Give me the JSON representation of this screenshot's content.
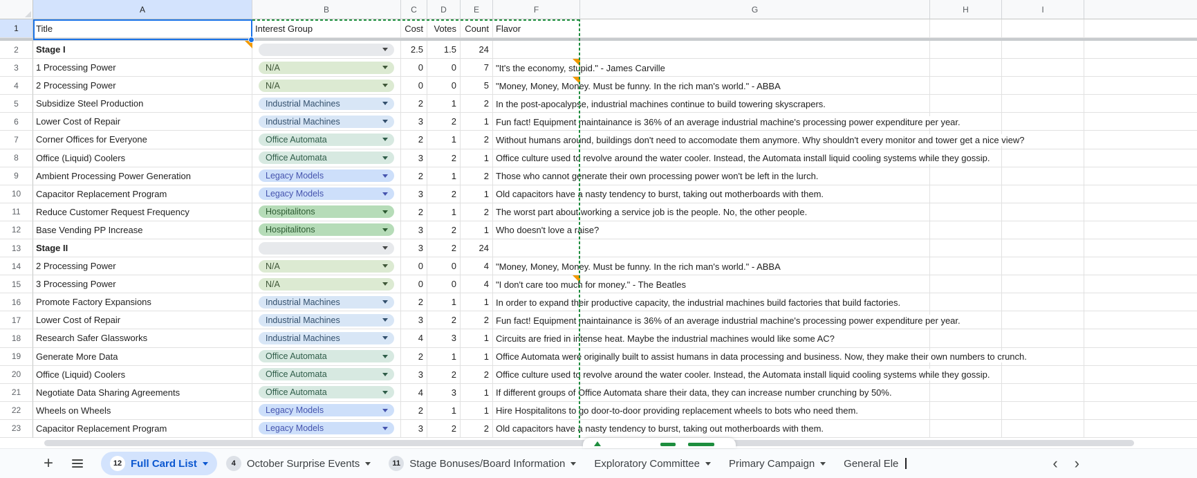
{
  "sheet": {
    "columns": [
      "A",
      "B",
      "C",
      "D",
      "E",
      "F",
      "G",
      "H",
      "I"
    ],
    "selected_cell": "A1",
    "header_row": {
      "num": "1",
      "title": "Title",
      "interest_group": "Interest Group",
      "cost": "Cost",
      "votes": "Votes",
      "count": "Count",
      "flavor": "Flavor"
    },
    "rows": [
      {
        "n": "2",
        "title": "Stage I",
        "bold": true,
        "group": "",
        "cost": "2.5",
        "votes": "1.5",
        "count": "24",
        "flavor": "",
        "notes": [
          "A"
        ]
      },
      {
        "n": "3",
        "title": "1 Processing Power",
        "bold": false,
        "group": "N/A",
        "cost": "0",
        "votes": "0",
        "count": "7",
        "flavor": "\"It's the economy, stupid.\" - James Carville",
        "notes": [
          "F"
        ]
      },
      {
        "n": "4",
        "title": "2 Processing Power",
        "bold": false,
        "group": "N/A",
        "cost": "0",
        "votes": "0",
        "count": "5",
        "flavor": "\"Money, Money, Money. Must be funny. In the rich man's world.\" - ABBA",
        "notes": [
          "F"
        ]
      },
      {
        "n": "5",
        "title": "Subsidize Steel Production",
        "bold": false,
        "group": "Industrial Machines",
        "cost": "2",
        "votes": "1",
        "count": "2",
        "flavor": "In the post-apocalypse, industrial machines continue to build towering skyscrapers.",
        "notes": []
      },
      {
        "n": "6",
        "title": "Lower Cost of Repair",
        "bold": false,
        "group": "Industrial Machines",
        "cost": "3",
        "votes": "2",
        "count": "1",
        "flavor": "Fun fact! Equipment maintainance is 36% of an average industrial machine's processing power expenditure per year.",
        "notes": []
      },
      {
        "n": "7",
        "title": "Corner Offices for Everyone",
        "bold": false,
        "group": "Office Automata",
        "cost": "2",
        "votes": "1",
        "count": "2",
        "flavor": "Without humans around, buildings don't need to accomodate them anymore. Why shouldn't every monitor and tower get a nice view?",
        "notes": []
      },
      {
        "n": "8",
        "title": "Office (Liquid) Coolers",
        "bold": false,
        "group": "Office Automata",
        "cost": "3",
        "votes": "2",
        "count": "1",
        "flavor": "Office culture used to revolve around the water cooler. Instead, the Automata install liquid cooling systems while they gossip.",
        "notes": []
      },
      {
        "n": "9",
        "title": "Ambient Processing Power Generation",
        "bold": false,
        "group": "Legacy Models",
        "cost": "2",
        "votes": "1",
        "count": "2",
        "flavor": "Those who cannot generate their own processing power won't be left in the lurch.",
        "notes": []
      },
      {
        "n": "10",
        "title": "Capacitor Replacement Program",
        "bold": false,
        "group": "Legacy Models",
        "cost": "3",
        "votes": "2",
        "count": "1",
        "flavor": "Old capacitors have a nasty tendency to burst, taking out motherboards with them.",
        "notes": []
      },
      {
        "n": "11",
        "title": "Reduce Customer Request Frequency",
        "bold": false,
        "group": "Hospitalitons",
        "cost": "2",
        "votes": "1",
        "count": "2",
        "flavor": "The worst part about working a service job is the people. No, the other people.",
        "notes": []
      },
      {
        "n": "12",
        "title": "Base Vending PP Increase",
        "bold": false,
        "group": "Hospitalitons",
        "cost": "3",
        "votes": "2",
        "count": "1",
        "flavor": "Who doesn't love a raise?",
        "notes": []
      },
      {
        "n": "13",
        "title": "Stage II",
        "bold": true,
        "group": "",
        "cost": "3",
        "votes": "2",
        "count": "24",
        "flavor": "",
        "notes": []
      },
      {
        "n": "14",
        "title": "2 Processing Power",
        "bold": false,
        "group": "N/A",
        "cost": "0",
        "votes": "0",
        "count": "4",
        "flavor": "\"Money, Money, Money. Must be funny. In the rich man's world.\" - ABBA",
        "notes": []
      },
      {
        "n": "15",
        "title": "3 Processing Power",
        "bold": false,
        "group": "N/A",
        "cost": "0",
        "votes": "0",
        "count": "4",
        "flavor": "\"I don't care too much for money.\" - The Beatles",
        "notes": [
          "F"
        ]
      },
      {
        "n": "16",
        "title": "Promote Factory Expansions",
        "bold": false,
        "group": "Industrial Machines",
        "cost": "2",
        "votes": "1",
        "count": "1",
        "flavor": "In order to expand their productive capacity, the industrial machines build factories that build factories.",
        "notes": []
      },
      {
        "n": "17",
        "title": "Lower Cost of Repair",
        "bold": false,
        "group": "Industrial Machines",
        "cost": "3",
        "votes": "2",
        "count": "2",
        "flavor": "Fun fact! Equipment maintainance is 36% of an average industrial machine's processing power expenditure per year.",
        "notes": []
      },
      {
        "n": "18",
        "title": "Research Safer Glassworks",
        "bold": false,
        "group": "Industrial Machines",
        "cost": "4",
        "votes": "3",
        "count": "1",
        "flavor": "Circuits are fried in intense heat. Maybe the industrial machines would like some AC?",
        "notes": []
      },
      {
        "n": "19",
        "title": "Generate More Data",
        "bold": false,
        "group": "Office Automata",
        "cost": "2",
        "votes": "1",
        "count": "1",
        "flavor": "Office Automata were originally built to assist humans in data processing and business. Now, they make their own numbers to crunch.",
        "notes": []
      },
      {
        "n": "20",
        "title": "Office (Liquid) Coolers",
        "bold": false,
        "group": "Office Automata",
        "cost": "3",
        "votes": "2",
        "count": "2",
        "flavor": "Office culture used to revolve around the water cooler. Instead, the Automata install liquid cooling systems while they gossip.",
        "notes": []
      },
      {
        "n": "21",
        "title": "Negotiate Data Sharing Agreements",
        "bold": false,
        "group": "Office Automata",
        "cost": "4",
        "votes": "3",
        "count": "1",
        "flavor": "If different groups of Office Automata share their data, they can increase number crunching by 50%.",
        "notes": []
      },
      {
        "n": "22",
        "title": "Wheels on Wheels",
        "bold": false,
        "group": "Legacy Models",
        "cost": "2",
        "votes": "1",
        "count": "1",
        "flavor": "Hire Hospitalitons to go door-to-door providing replacement wheels to bots who need them.",
        "notes": []
      },
      {
        "n": "23",
        "title": "Capacitor Replacement Program",
        "bold": false,
        "group": "Legacy Models",
        "cost": "3",
        "votes": "2",
        "count": "2",
        "flavor": "Old capacitors have a nasty tendency to burst, taking out motherboards with them.",
        "notes": []
      }
    ],
    "group_styles": {
      "N/A": {
        "bg": "#dcead2",
        "text": "#3f5738"
      },
      "Industrial Machines": {
        "bg": "#d8e6f6",
        "text": "#33506d"
      },
      "Office Automata": {
        "bg": "#d7e9e1",
        "text": "#2f5d49"
      },
      "Legacy Models": {
        "bg": "#cddffa",
        "text": "#4554ae"
      },
      "Hospitalitons": {
        "bg": "#b6dcb8",
        "text": "#2c5a31"
      },
      "": {
        "bg": "#e7e9ec",
        "text": "#444746"
      }
    },
    "colors": {
      "selection_blue": "#1a73e8",
      "marquee_green": "#1e8e3e",
      "note_orange": "#f29900",
      "selected_header_bg": "#d3e3fd"
    }
  },
  "tab_bar": {
    "add_sheet_icon": "+",
    "all_sheets_icon": "hamburger",
    "scroll_left_icon": "‹",
    "scroll_right_icon": "›",
    "tabs": [
      {
        "badge": "12",
        "label": "Full Card List",
        "active": true,
        "has_arrow": true,
        "editing": false
      },
      {
        "badge": "4",
        "label": "October Surprise Events",
        "active": false,
        "has_arrow": true,
        "editing": false
      },
      {
        "badge": "11",
        "label": "Stage Bonuses/Board Information",
        "active": false,
        "has_arrow": true,
        "editing": false
      },
      {
        "badge": "",
        "label": "Exploratory Committee",
        "active": false,
        "has_arrow": true,
        "editing": false
      },
      {
        "badge": "",
        "label": "Primary Campaign",
        "active": false,
        "has_arrow": true,
        "editing": false
      },
      {
        "badge": "",
        "label": "General Ele",
        "active": false,
        "has_arrow": false,
        "editing": true
      }
    ]
  }
}
